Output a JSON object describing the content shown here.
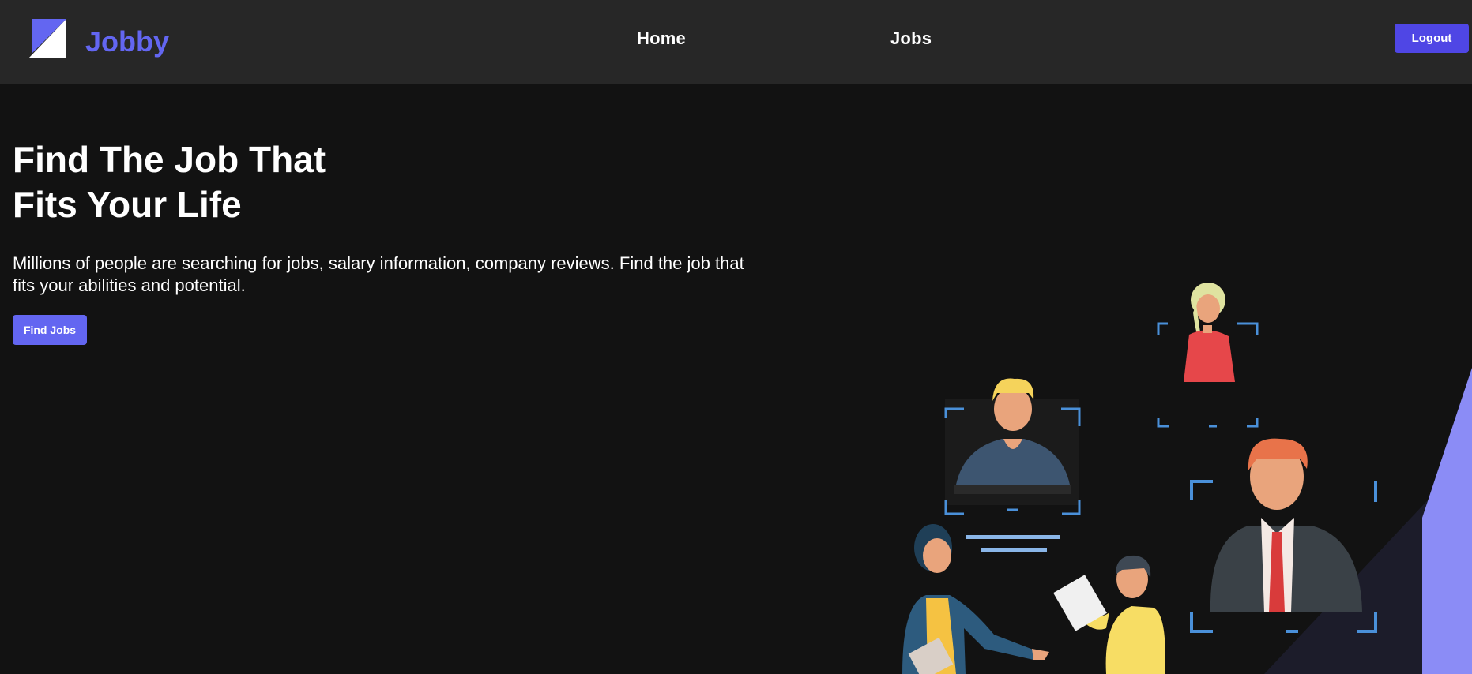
{
  "navbar": {
    "logo": {
      "text": "Jobby",
      "icon": "jobby-logo-icon",
      "color": "#6366f1"
    },
    "links": [
      {
        "label": "Home"
      },
      {
        "label": "Jobs"
      }
    ],
    "logout_label": "Logout"
  },
  "hero": {
    "heading_line1": "Find The Job That",
    "heading_line2": "Fits Your Life",
    "description": "Millions of people are searching for jobs, salary information, company reviews. Find the job that fits your abilities and potential.",
    "cta_label": "Find Jobs"
  },
  "theme": {
    "background": "#121212",
    "navbar_bg": "#272727",
    "accent": "#6366f1",
    "logout_bg": "#4f46e5"
  }
}
